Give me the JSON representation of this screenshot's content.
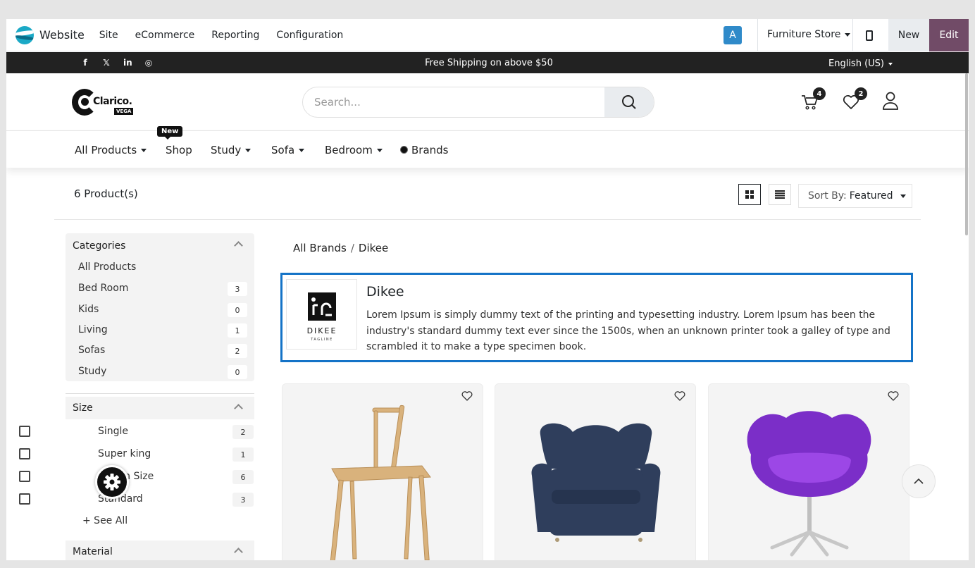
{
  "odoo_bar": {
    "app_name": "Website",
    "menu": [
      "Site",
      "eCommerce",
      "Reporting",
      "Configuration"
    ],
    "avatar_letter": "A",
    "store": "Furniture Store",
    "new_label": "New",
    "edit_label": "Edit"
  },
  "promo": {
    "text": "Free Shipping on above $50",
    "language": "English (US)",
    "social_icons": [
      "facebook-icon",
      "x-icon",
      "linkedin-icon",
      "instagram-icon"
    ]
  },
  "header": {
    "logo_name": "Clarico.",
    "logo_sub": "VEGA",
    "search_placeholder": "Search...",
    "cart_count": "4",
    "wishlist_count": "2"
  },
  "nav": {
    "items": [
      "All Products",
      "Shop",
      "Study",
      "Sofa",
      "Bedroom",
      "Brands"
    ],
    "new_badge": "New"
  },
  "toolbar": {
    "count": "6 Product(s)",
    "sort_label": "Sort By:",
    "sort_value": "Featured"
  },
  "sidebar": {
    "categories_title": "Categories",
    "categories": [
      {
        "label": "All Products",
        "count": ""
      },
      {
        "label": "Bed Room",
        "count": "3"
      },
      {
        "label": "Kids",
        "count": "0"
      },
      {
        "label": "Living",
        "count": "1"
      },
      {
        "label": "Sofas",
        "count": "2"
      },
      {
        "label": "Study",
        "count": "0"
      }
    ],
    "size_title": "Size",
    "sizes": [
      {
        "label": "Single",
        "count": "2"
      },
      {
        "label": "Super king",
        "count": "1"
      },
      {
        "label": "Queen Size",
        "count": "6"
      },
      {
        "label": "Standard",
        "count": "3"
      }
    ],
    "see_all": "+ See All",
    "material_title": "Material"
  },
  "main": {
    "breadcrumb": [
      "All Brands",
      "Dikee"
    ],
    "brand": {
      "name": "Dikee",
      "logo_text": "DIKEE",
      "logo_tagline": "TAGLINE",
      "description": "Lorem Ipsum is simply dummy text of the printing and typesetting industry. Lorem Ipsum has been the industry's standard dummy text ever since the 1500s, when an unknown printer took a galley of type and scrambled it to make a type specimen book."
    },
    "products": [
      {
        "image": "wooden-chair",
        "color": "#d9b27c"
      },
      {
        "image": "navy-armchair",
        "color": "#2f3e5c"
      },
      {
        "image": "purple-swivel-chair",
        "color": "#7b2ec8"
      }
    ]
  },
  "colors": {
    "odoo_primary": "#714b67",
    "avatar": "#2f8ac9",
    "brand_card_border": "#1473c7",
    "promo_bg": "#222222"
  }
}
